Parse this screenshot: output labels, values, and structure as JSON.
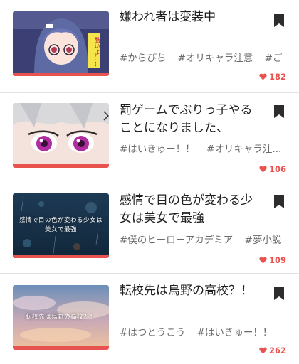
{
  "colors": {
    "accent": "#e8524f",
    "text": "#1f1f1f",
    "tag": "#6b6b6b"
  },
  "stories": [
    {
      "title": "嫌われ者は変装中",
      "tags": [
        "#からぴち",
        "#オリキャラ注意",
        "#ご"
      ],
      "likes": "182",
      "thumb_icon": "anime-girl-glasses-illustration",
      "thumb_text": "酷いよ……"
    },
    {
      "title": "罰ゲームでぶりっ子やることになりました、",
      "tags": [
        "#はいきゅー！！",
        "#オリキャラ注..."
      ],
      "likes": "106",
      "thumb_icon": "anime-eyes-closeup-illustration"
    },
    {
      "title": "感情で目の色が変わる少女は美女で最強",
      "tags": [
        "#僕のヒーローアカデミア",
        "#夢小説"
      ],
      "likes": "109",
      "thumb_icon": "rainy-night-title-card",
      "thumb_text": "感情で目の色が変わる少女は美女で最強"
    },
    {
      "title": "転校先は烏野の高校？！",
      "tags": [
        "#はつとうこう",
        "#はいきゅー！！"
      ],
      "likes": "262",
      "thumb_icon": "sunset-sky-title-card",
      "thumb_text": "転校先は烏野の高校？！"
    }
  ]
}
